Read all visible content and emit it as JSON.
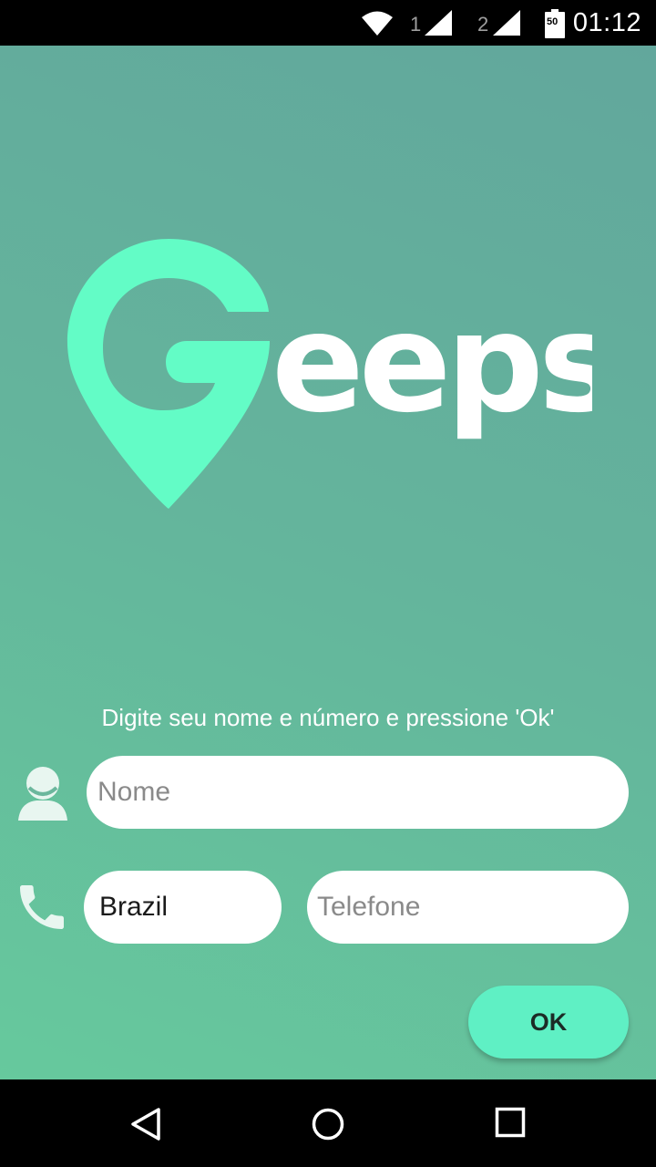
{
  "status_bar": {
    "time": "01:12",
    "sim1_label": "1",
    "sim2_label": "2",
    "battery_level": "50",
    "icons": [
      "wifi-icon",
      "signal-icon",
      "signal-icon",
      "battery-icon"
    ]
  },
  "logo": {
    "text": "Geeps",
    "pin_color": "#63fcc6",
    "text_color": "#ffffff"
  },
  "form": {
    "instruction": "Digite seu nome e número e pressione 'Ok'",
    "name_placeholder": "Nome",
    "country_value": "Brazil",
    "phone_placeholder": "Telefone",
    "submit_label": "OK"
  },
  "colors": {
    "accent": "#5ff0c4",
    "background_top": "#62a79c",
    "background_bottom": "#66c99d"
  },
  "nav_bar": {
    "icons": [
      "back-icon",
      "home-icon",
      "recents-icon"
    ]
  }
}
